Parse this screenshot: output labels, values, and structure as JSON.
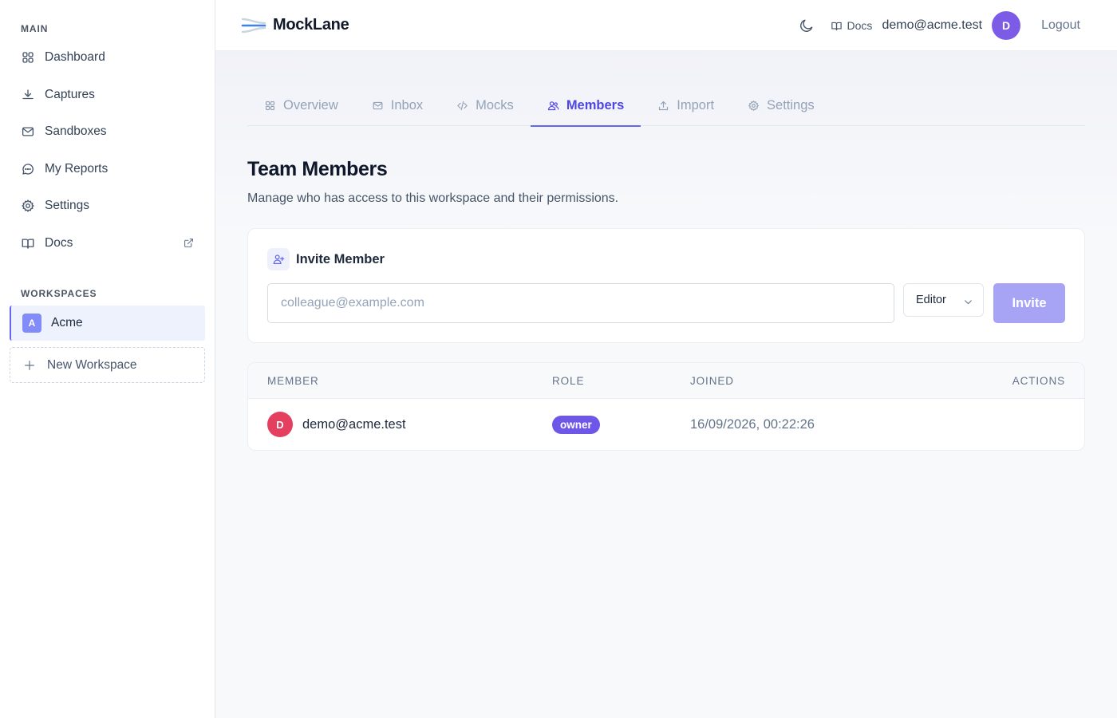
{
  "sidebar": {
    "main_label": "MAIN",
    "items": [
      {
        "label": "Dashboard",
        "icon": "dashboard-icon"
      },
      {
        "label": "Captures",
        "icon": "download-icon"
      },
      {
        "label": "Sandboxes",
        "icon": "mail-icon"
      },
      {
        "label": "My Reports",
        "icon": "chat-icon"
      },
      {
        "label": "Settings",
        "icon": "gear-icon"
      },
      {
        "label": "Docs",
        "icon": "book-icon",
        "external": true
      }
    ],
    "workspaces_label": "WORKSPACES",
    "workspaces": [
      {
        "initial": "A",
        "name": "Acme",
        "active": true
      }
    ],
    "new_workspace_label": "New Workspace"
  },
  "header": {
    "brand": "MockLane",
    "docs_label": "Docs",
    "user_email": "demo@acme.test",
    "user_initial": "D",
    "logout_label": "Logout"
  },
  "tabs": [
    {
      "label": "Overview",
      "icon": "grid-icon",
      "active": false
    },
    {
      "label": "Inbox",
      "icon": "mail-icon",
      "active": false
    },
    {
      "label": "Mocks",
      "icon": "code-icon",
      "active": false
    },
    {
      "label": "Members",
      "icon": "users-icon",
      "active": true
    },
    {
      "label": "Import",
      "icon": "upload-icon",
      "active": false
    },
    {
      "label": "Settings",
      "icon": "gear-icon",
      "active": false
    }
  ],
  "page": {
    "title": "Team Members",
    "subtitle": "Manage who has access to this workspace and their permissions."
  },
  "invite": {
    "title": "Invite Member",
    "email_placeholder": "colleague@example.com",
    "email_value": "",
    "role_selected": "Editor",
    "button_label": "Invite"
  },
  "members_table": {
    "columns": [
      "MEMBER",
      "ROLE",
      "JOINED",
      "ACTIONS"
    ],
    "rows": [
      {
        "initial": "D",
        "email": "demo@acme.test",
        "role": "owner",
        "joined": "16/09/2026, 00:22:26"
      }
    ]
  },
  "colors": {
    "accent": "#6366f1",
    "user_avatar": "#7c5ce6",
    "member_avatar": "#e43f5e",
    "owner_badge": "#6d56e8",
    "invite_button": "#a8a4f5"
  }
}
